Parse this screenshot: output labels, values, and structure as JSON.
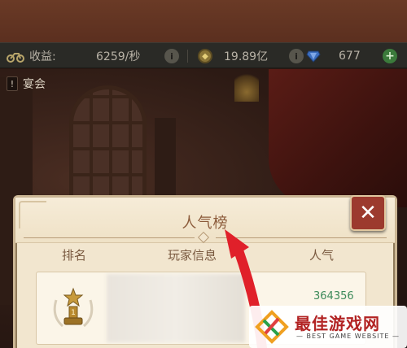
{
  "resource_bar": {
    "income_label": "收益:",
    "income_value": "6259/秒",
    "gold_value": "19.89亿",
    "gem_value": "677"
  },
  "banquet": {
    "label": "宴会"
  },
  "popularity_panel": {
    "title": "人气榜",
    "columns": {
      "rank": "排名",
      "player_info": "玩家信息",
      "popularity": "人气"
    },
    "rows": [
      {
        "popularity": "364356"
      }
    ]
  },
  "icons": {
    "income": "motorbike-icon",
    "info": "info-icon",
    "gold": "gold-coin-icon",
    "gem": "blue-gem-icon",
    "add": "plus-icon",
    "close": "close-icon",
    "rank": "trophy-icon"
  },
  "watermark": {
    "title": "最佳游戏网",
    "subtitle": "— BEST GAME WEBSITE —"
  },
  "colors": {
    "panel_bg": "#f2e6cf",
    "title": "#8b5a3a",
    "popularity_value": "#3d8a5a",
    "close_button": "#9c3a2e",
    "arrow": "#e0202a"
  }
}
